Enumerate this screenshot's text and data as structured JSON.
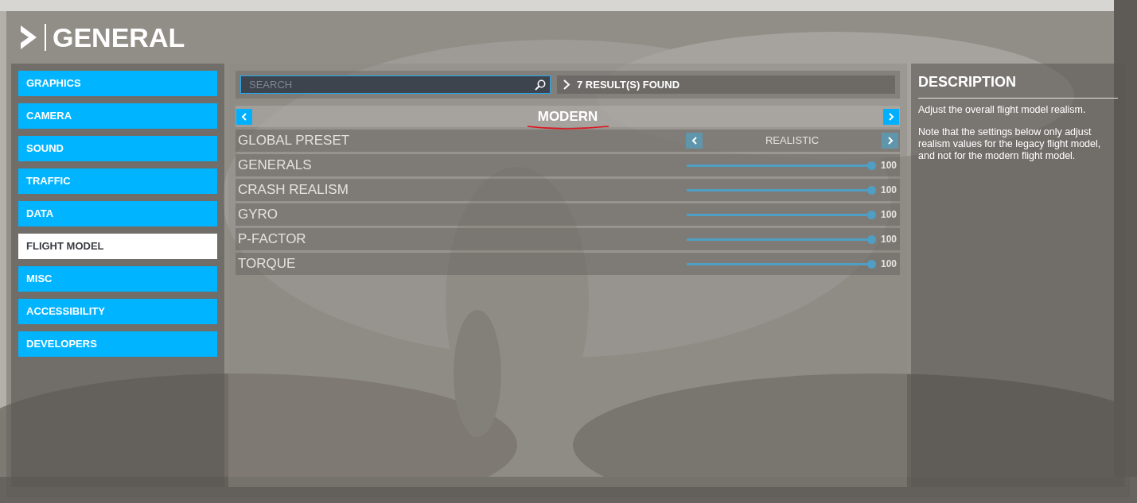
{
  "header": {
    "title": "GENERAL"
  },
  "sidebar": {
    "items": [
      {
        "label": "GRAPHICS",
        "selected": false
      },
      {
        "label": "CAMERA",
        "selected": false
      },
      {
        "label": "SOUND",
        "selected": false
      },
      {
        "label": "TRAFFIC",
        "selected": false
      },
      {
        "label": "DATA",
        "selected": false
      },
      {
        "label": "FLIGHT MODEL",
        "selected": true
      },
      {
        "label": "MISC",
        "selected": false
      },
      {
        "label": "ACCESSIBILITY",
        "selected": false
      },
      {
        "label": "DEVELOPERS",
        "selected": false
      }
    ]
  },
  "search": {
    "placeholder": "SEARCH",
    "results": "7 RESULT(S) FOUND"
  },
  "model_selector": {
    "value": "MODERN",
    "underlined": true
  },
  "settings": [
    {
      "kind": "selector",
      "label": "GLOBAL PRESET",
      "value": "REALISTIC",
      "disabled": true
    },
    {
      "kind": "slider",
      "label": "GENERALS",
      "level": 1,
      "reading": "100",
      "disabled": true
    },
    {
      "kind": "slider",
      "label": "CRASH REALISM",
      "level": 1,
      "reading": "100",
      "disabled": true
    },
    {
      "kind": "slider",
      "label": "GYRO",
      "level": 1,
      "reading": "100",
      "disabled": true
    },
    {
      "kind": "slider",
      "label": "P-FACTOR",
      "level": 1,
      "reading": "100",
      "disabled": true
    },
    {
      "kind": "slider",
      "label": "TORQUE",
      "level": 1,
      "reading": "100",
      "disabled": true
    }
  ],
  "description": {
    "title": "DESCRIPTION",
    "paragraphs": [
      "Adjust the overall flight model realism.",
      "Note that the settings below only adjust realism values for the legacy flight model, and not for the modern flight model."
    ]
  }
}
